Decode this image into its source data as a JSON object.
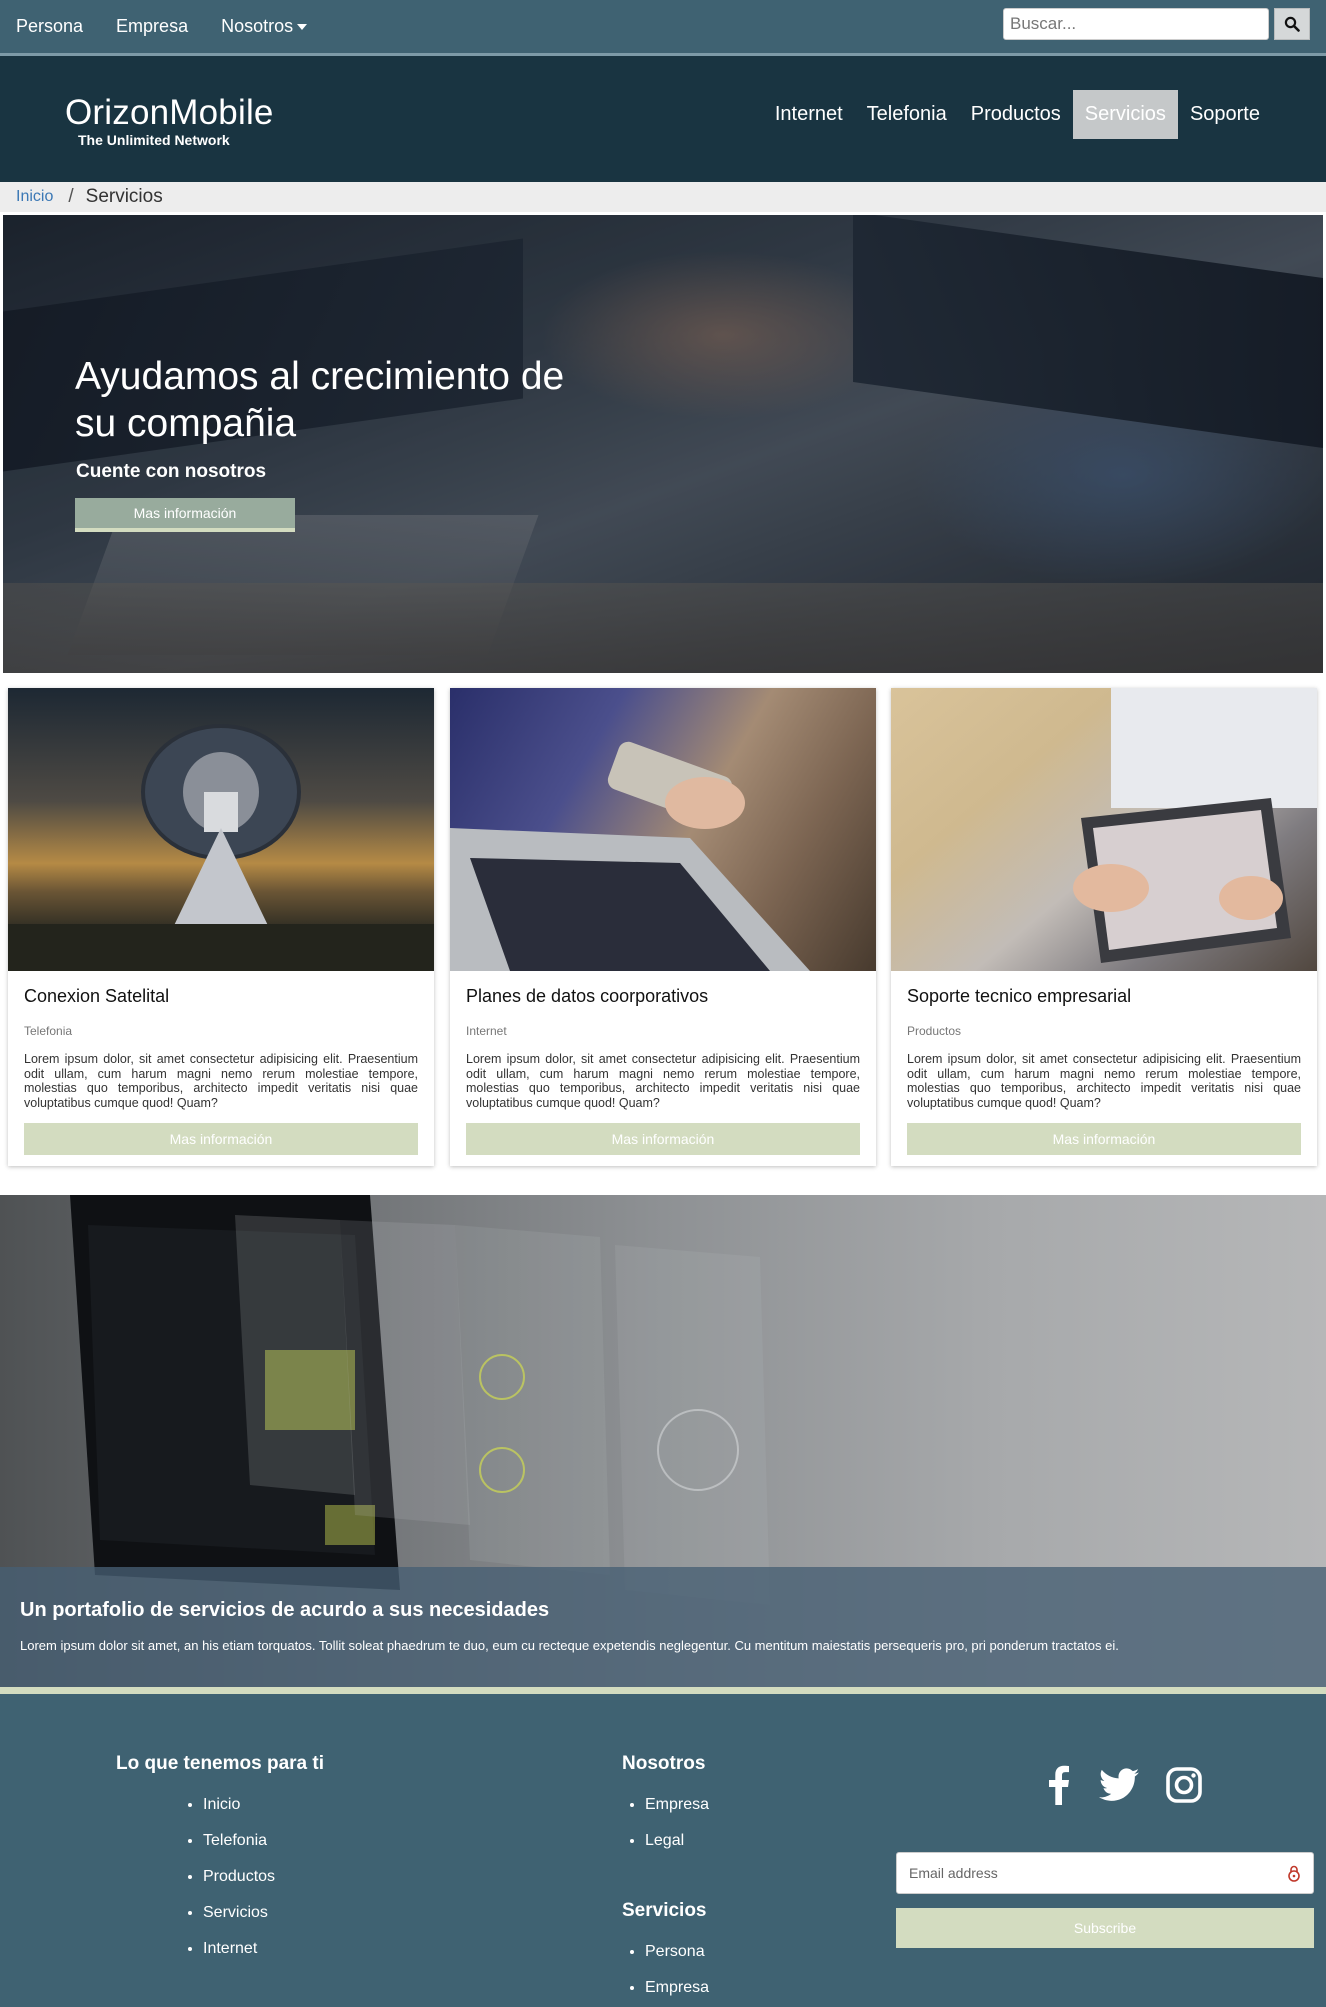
{
  "topbar": {
    "links": [
      {
        "label": "Persona"
      },
      {
        "label": "Empresa"
      },
      {
        "label": "Nosotros"
      }
    ],
    "search": {
      "placeholder": "Buscar..."
    }
  },
  "header": {
    "logo_name": "OrizonMobile",
    "logo_tagline": "The Unlimited Network",
    "nav": [
      {
        "label": "Internet"
      },
      {
        "label": "Telefonia"
      },
      {
        "label": "Productos"
      },
      {
        "label": "Servicios",
        "active": true
      },
      {
        "label": "Soporte"
      }
    ]
  },
  "breadcrumb": {
    "home": "Inicio",
    "separator": "/",
    "current": "Servicios"
  },
  "hero": {
    "title": "Ayudamos al crecimiento de su compañia",
    "subtitle": "Cuente con nosotros",
    "button": "Mas información"
  },
  "cards": [
    {
      "title": "Conexion Satelital",
      "category": "Telefonia",
      "text": "Lorem ipsum dolor, sit amet consectetur adipisicing elit. Praesentium odit ullam, cum harum magni nemo rerum molestiae tempore, molestias quo temporibus, architecto impedit veritatis nisi quae voluptatibus cumque quod! Quam?",
      "button": "Mas información"
    },
    {
      "title": "Planes de datos coorporativos",
      "category": "Internet",
      "text": "Lorem ipsum dolor, sit amet consectetur adipisicing elit. Praesentium odit ullam, cum harum magni nemo rerum molestiae tempore, molestias quo temporibus, architecto impedit veritatis nisi quae voluptatibus cumque quod! Quam?",
      "button": "Mas información"
    },
    {
      "title": "Soporte tecnico empresarial",
      "category": "Productos",
      "text": "Lorem ipsum dolor, sit amet consectetur adipisicing elit. Praesentium odit ullam, cum harum magni nemo rerum molestiae tempore, molestias quo temporibus, architecto impedit veritatis nisi quae voluptatibus cumque quod! Quam?",
      "button": "Mas información"
    }
  ],
  "portfolio": {
    "title": "Un portafolio de servicios de acurdo a sus necesidades",
    "text": "Lorem ipsum dolor sit amet, an his etiam torquatos. Tollit soleat phaedrum te duo, eum cu recteque expetendis neglegentur. Cu mentitum maiestatis persequeris pro, pri ponderum tractatos ei."
  },
  "footer": {
    "col1": {
      "heading": "Lo que tenemos para ti",
      "items": [
        "Inicio",
        "Telefonia",
        "Productos",
        "Servicios",
        "Internet"
      ]
    },
    "col2": {
      "heading": "Nosotros",
      "items": [
        "Empresa",
        "Legal"
      ]
    },
    "col3": {
      "heading": "Servicios",
      "items": [
        "Persona",
        "Empresa"
      ]
    },
    "social": [
      "facebook-icon",
      "twitter-icon",
      "instagram-icon"
    ],
    "email": {
      "placeholder": "Email address"
    },
    "subscribe": "Subscribe"
  },
  "colors": {
    "topbar": "#3f6272",
    "header": "#193441",
    "accent": "#d3dcc0",
    "nav_active": "#c5c8c9",
    "link": "#3b78b5",
    "email_icon": "#c0392b"
  }
}
